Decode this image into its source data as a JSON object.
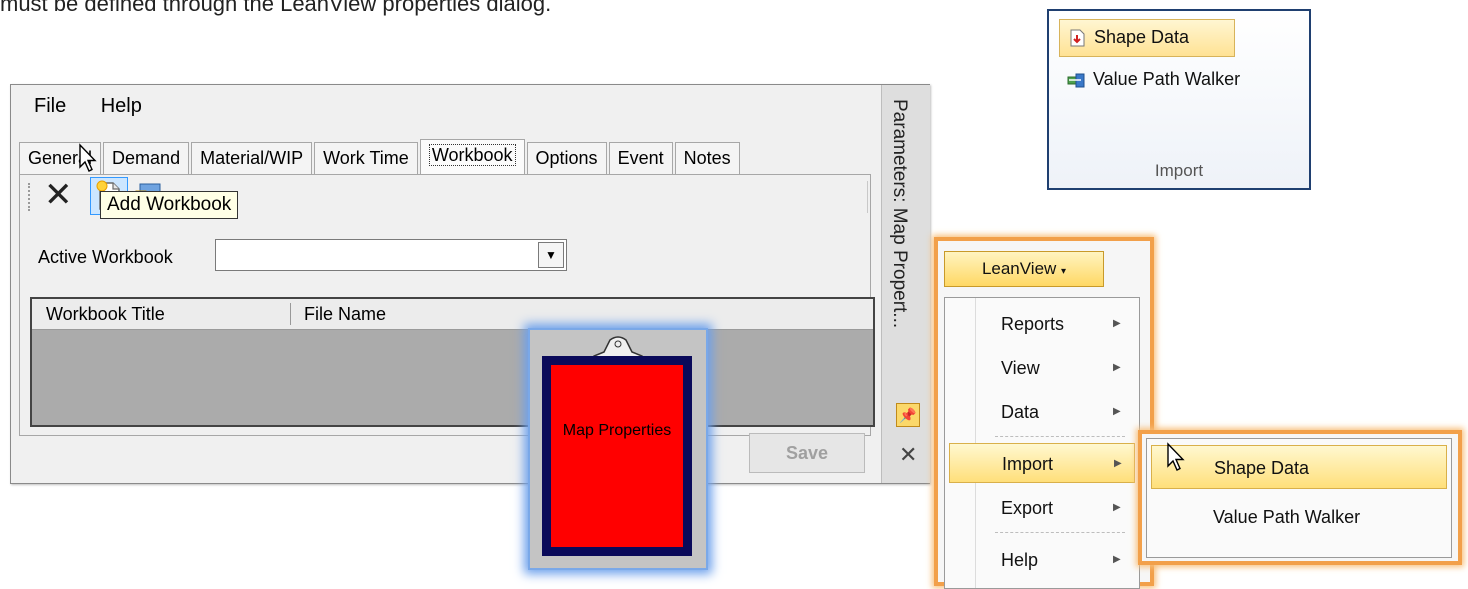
{
  "intro_text": "must be defined through the LeanView properties dialog.",
  "params_window": {
    "menu": [
      "File",
      "Help"
    ],
    "tabs": [
      "General",
      "Demand",
      "Material/WIP",
      "Work Time",
      "Workbook",
      "Options",
      "Event",
      "Notes"
    ],
    "active_tab": "Workbook",
    "toolbar": {
      "delete_icon": "delete-icon",
      "new_icon": "new-workbook-icon",
      "open_icon": "open-folder-icon"
    },
    "active_workbook_label": "Active Workbook",
    "active_workbook_value": "",
    "tooltip": "Add Workbook",
    "grid_columns": [
      "Workbook Title",
      "File Name"
    ],
    "save_label": "Save",
    "sidebar_title": "Parameters: Map Propert...",
    "pin_icon": "pin-icon",
    "close_icon": "close-icon"
  },
  "map_properties_icon": {
    "label": "Map Properties",
    "fill_color": "#ff0000",
    "border_color": "#0a0a5a"
  },
  "leanview_menu": {
    "button_label": "LeanView",
    "items": [
      {
        "label": "Reports",
        "submenu": true
      },
      {
        "label": "View",
        "submenu": true
      },
      {
        "label": "Data",
        "submenu": true
      },
      {
        "label": "Import",
        "submenu": true,
        "highlighted": true
      },
      {
        "label": "Export",
        "submenu": true
      },
      {
        "label": "Help",
        "submenu": true
      }
    ],
    "import_submenu": [
      "Shape Data",
      "Value Path Walker"
    ],
    "highlight_color": "#f2a04a"
  },
  "ribbon": {
    "buttons": [
      {
        "label": "Shape Data",
        "icon": "shape-data-icon",
        "highlighted": true
      },
      {
        "label": "Value Path Walker",
        "icon": "value-path-walker-icon"
      }
    ],
    "group_label": "Import"
  }
}
